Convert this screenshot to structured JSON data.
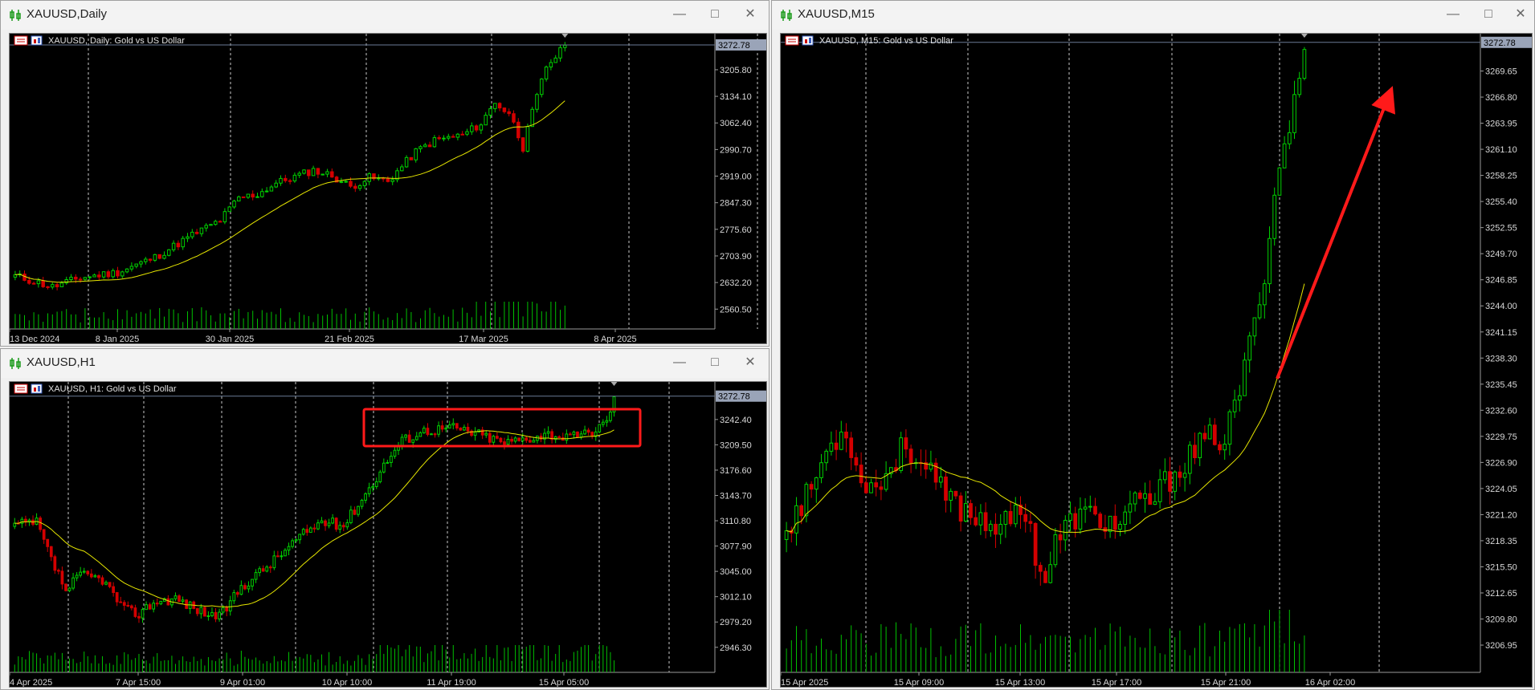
{
  "colors": {
    "bull": "#00d000",
    "bear": "#d40000",
    "ma": "#e6e600",
    "volume": "#00c000",
    "grid": "#c8c8c8",
    "axis_text": "#d8d8d8",
    "current_price_bg": "#9aa4b8",
    "annotation": "#ff1a1a"
  },
  "icons": {
    "window": "candlestick-window-icon",
    "minimize": "minimize-icon",
    "maximize": "maximize-icon",
    "close": "close-icon",
    "chart_type": "bar-chart-icon",
    "symbol": "chart-properties-icon"
  },
  "windows": [
    {
      "id": "daily",
      "title": "XAUUSD,Daily",
      "chart_label": "XAUUSD, Daily:  Gold vs US Dollar",
      "current_price": "3272.78",
      "price_ticks": [
        "3205.80",
        "3134.10",
        "3062.40",
        "2990.70",
        "2919.00",
        "2847.30",
        "2775.60",
        "2703.90",
        "2632.20",
        "2560.50"
      ],
      "time_ticks": [
        "13 Dec 2024",
        "8 Jan 2025",
        "30 Jan 2025",
        "21 Feb 2025",
        "17 Mar 2025",
        "8 Apr 2025"
      ]
    },
    {
      "id": "h1",
      "title": "XAUUSD,H1",
      "chart_label": "XAUUSD, H1:  Gold vs US Dollar",
      "current_price": "3272.78",
      "price_ticks": [
        "3242.40",
        "3209.50",
        "3176.60",
        "3143.70",
        "3110.80",
        "3077.90",
        "3045.00",
        "3012.10",
        "2979.20",
        "2946.30"
      ],
      "time_ticks": [
        "4 Apr 2025",
        "7 Apr 15:00",
        "9 Apr 01:00",
        "10 Apr 10:00",
        "11 Apr 19:00",
        "15 Apr 05:00"
      ]
    },
    {
      "id": "m15",
      "title": "XAUUSD,M15",
      "chart_label": "XAUUSD, M15:  Gold vs US Dollar",
      "current_price": "3272.78",
      "price_ticks": [
        "3269.65",
        "3266.80",
        "3263.95",
        "3261.10",
        "3258.25",
        "3255.40",
        "3252.55",
        "3249.70",
        "3246.85",
        "3244.00",
        "3241.15",
        "3238.30",
        "3235.45",
        "3232.60",
        "3229.75",
        "3226.90",
        "3224.05",
        "3221.20",
        "3218.35",
        "3215.50",
        "3212.65",
        "3209.80",
        "3206.95"
      ],
      "time_ticks": [
        "15 Apr 2025",
        "15 Apr 09:00",
        "15 Apr 13:00",
        "15 Apr 17:00",
        "15 Apr 21:00",
        "16 Apr 02:00"
      ]
    }
  ],
  "chart_data": [
    {
      "type": "candlestick",
      "series": "XAUUSD Daily",
      "x_range": [
        "13 Dec 2024",
        "15 Apr 2025"
      ],
      "ylim": [
        2520,
        3290
      ],
      "anchors": [
        [
          0,
          2650
        ],
        [
          8,
          2620
        ],
        [
          14,
          2645
        ],
        [
          22,
          2660
        ],
        [
          30,
          2700
        ],
        [
          38,
          2760
        ],
        [
          44,
          2800
        ],
        [
          48,
          2860
        ],
        [
          52,
          2870
        ],
        [
          56,
          2900
        ],
        [
          64,
          2935
        ],
        [
          68,
          2920
        ],
        [
          72,
          2890
        ],
        [
          76,
          2915
        ],
        [
          80,
          2905
        ],
        [
          86,
          2985
        ],
        [
          90,
          3015
        ],
        [
          96,
          3030
        ],
        [
          100,
          3060
        ],
        [
          103,
          3120
        ],
        [
          107,
          3070
        ],
        [
          109,
          2995
        ],
        [
          111,
          3090
        ],
        [
          114,
          3215
        ],
        [
          117,
          3255
        ],
        [
          118,
          3272
        ]
      ],
      "moving_average": "yellow line"
    },
    {
      "type": "candlestick",
      "series": "XAUUSD H1",
      "x_range": [
        "4 Apr 2025",
        "16 Apr 2025"
      ],
      "ylim": [
        2920,
        3285
      ],
      "anchors": [
        [
          0,
          3105
        ],
        [
          6,
          3108
        ],
        [
          10,
          3060
        ],
        [
          14,
          3020
        ],
        [
          18,
          3040
        ],
        [
          24,
          3035
        ],
        [
          30,
          2995
        ],
        [
          34,
          2990
        ],
        [
          38,
          3005
        ],
        [
          44,
          3010
        ],
        [
          50,
          2995
        ],
        [
          56,
          2985
        ],
        [
          62,
          3025
        ],
        [
          70,
          3055
        ],
        [
          78,
          3090
        ],
        [
          84,
          3110
        ],
        [
          90,
          3105
        ],
        [
          98,
          3160
        ],
        [
          102,
          3190
        ],
        [
          106,
          3215
        ],
        [
          112,
          3228
        ],
        [
          120,
          3232
        ],
        [
          128,
          3222
        ],
        [
          134,
          3212
        ],
        [
          140,
          3218
        ],
        [
          146,
          3224
        ],
        [
          152,
          3218
        ],
        [
          158,
          3226
        ],
        [
          162,
          3240
        ],
        [
          164,
          3272
        ]
      ],
      "moving_average": "yellow line"
    },
    {
      "type": "candlestick",
      "series": "XAUUSD M15",
      "x_range": [
        "15 Apr 2025",
        "16 Apr 2025"
      ],
      "ylim": [
        3204.5,
        3273.2
      ],
      "anchors": [
        [
          0,
          3220
        ],
        [
          4,
          3223
        ],
        [
          8,
          3228
        ],
        [
          12,
          3231
        ],
        [
          14,
          3226
        ],
        [
          18,
          3224
        ],
        [
          24,
          3229
        ],
        [
          28,
          3226
        ],
        [
          32,
          3223
        ],
        [
          38,
          3221
        ],
        [
          44,
          3220
        ],
        [
          48,
          3222
        ],
        [
          50,
          3217
        ],
        [
          52,
          3214
        ],
        [
          54,
          3218
        ],
        [
          58,
          3221
        ],
        [
          62,
          3221
        ],
        [
          66,
          3220
        ],
        [
          70,
          3222
        ],
        [
          74,
          3223
        ],
        [
          78,
          3226
        ],
        [
          82,
          3228
        ],
        [
          86,
          3230
        ],
        [
          88,
          3229
        ],
        [
          90,
          3233
        ],
        [
          92,
          3237
        ],
        [
          94,
          3242
        ],
        [
          96,
          3248
        ],
        [
          98,
          3256
        ],
        [
          100,
          3262
        ],
        [
          102,
          3266
        ],
        [
          104,
          3272
        ]
      ],
      "moving_average": "yellow line"
    }
  ]
}
